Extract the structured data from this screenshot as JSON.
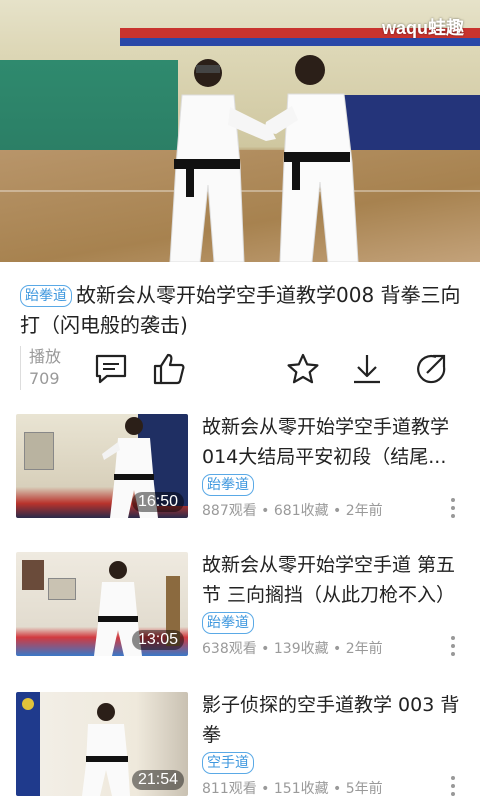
{
  "player": {
    "logo": "waqu蛙趣"
  },
  "video": {
    "tag": "跆拳道",
    "title": "故新会从零开始学空手道教学008 背拳三向打（闪电般的袭击)",
    "plays_label": "播放",
    "plays_count": "709"
  },
  "actions": {
    "icons": [
      "comment-icon",
      "like-icon",
      "star-icon",
      "download-icon",
      "share-icon"
    ]
  },
  "list": [
    {
      "title": "故新会从零开始学空手道教学014大结局平安初段（结尾...",
      "tag": "跆拳道",
      "meta": "887观看 • 681收藏 • 2年前",
      "duration": "16:50"
    },
    {
      "title": "故新会从零开始学空手道 第五节 三向搁挡（从此刀枪不入）",
      "tag": "跆拳道",
      "meta": "638观看 • 139收藏 • 2年前",
      "duration": "13:05"
    },
    {
      "title": "影子侦探的空手道教学  003 背拳",
      "tag": "空手道",
      "meta": "811观看 • 151收藏 • 5年前",
      "duration": "21:54"
    }
  ],
  "colors": {
    "accent": "#3d97de",
    "meta": "#9a9a9a"
  }
}
